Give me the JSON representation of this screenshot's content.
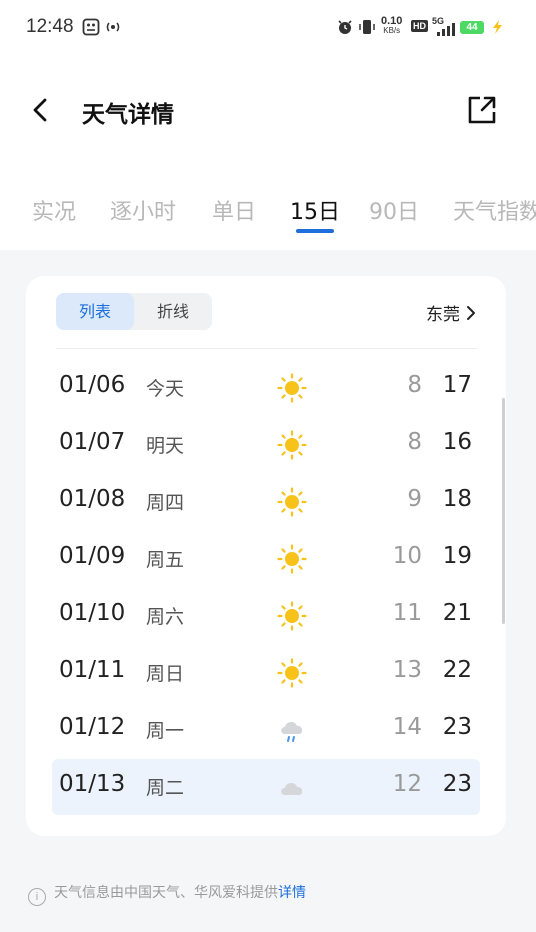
{
  "status_bar": {
    "time": "12:48",
    "net_speed_value": "0.10",
    "net_speed_unit": "KB/s",
    "hd": "HD",
    "net_type": "5G",
    "battery": "44"
  },
  "header": {
    "title": "天气详情"
  },
  "tabs": [
    "实况",
    "逐小时",
    "单日",
    "15日",
    "90日",
    "天气指数"
  ],
  "segment": {
    "list_label": "列表",
    "line_label": "折线"
  },
  "city": "东莞",
  "forecast": [
    {
      "date": "01/06",
      "weekday": "今天",
      "icon": "sun-icon",
      "low": "8",
      "high": "17"
    },
    {
      "date": "01/07",
      "weekday": "明天",
      "icon": "sun-icon",
      "low": "8",
      "high": "16"
    },
    {
      "date": "01/08",
      "weekday": "周四",
      "icon": "sun-icon",
      "low": "9",
      "high": "18"
    },
    {
      "date": "01/09",
      "weekday": "周五",
      "icon": "sun-icon",
      "low": "10",
      "high": "19"
    },
    {
      "date": "01/10",
      "weekday": "周六",
      "icon": "sun-icon",
      "low": "11",
      "high": "21"
    },
    {
      "date": "01/11",
      "weekday": "周日",
      "icon": "sun-icon",
      "low": "13",
      "high": "22"
    },
    {
      "date": "01/12",
      "weekday": "周一",
      "icon": "light-rain-icon",
      "low": "14",
      "high": "23"
    },
    {
      "date": "01/13",
      "weekday": "周二",
      "icon": "cloudy-icon",
      "low": "12",
      "high": "23"
    }
  ],
  "footer": {
    "text": "天气信息由中国天气、华风爱科提供",
    "link": "详情"
  },
  "colors": {
    "accent": "#1e6fdc",
    "sun": "#f7c21a",
    "cloud": "#d4d6d9",
    "rain": "#4b95e8"
  }
}
